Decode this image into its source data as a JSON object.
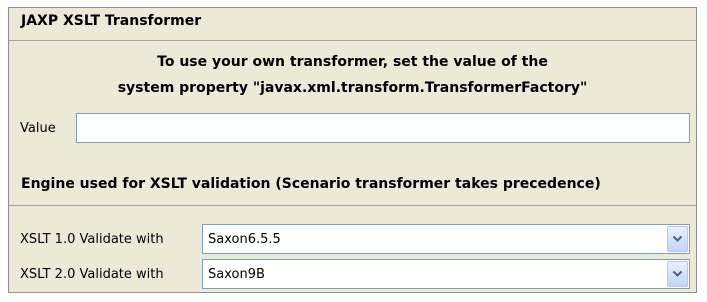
{
  "panel": {
    "title": "JAXP XSLT Transformer",
    "note_line1": "To use your own transformer, set the value of the",
    "note_line2": "system property \"javax.xml.transform.TransformerFactory\"",
    "value_label": "Value",
    "value_input": ""
  },
  "engine": {
    "title": "Engine used for XSLT validation (Scenario transformer takes precedence)",
    "rows": [
      {
        "label": "XSLT 1.0 Validate with",
        "selected": "Saxon6.5.5"
      },
      {
        "label": "XSLT 2.0 Validate with",
        "selected": "Saxon9B"
      }
    ]
  },
  "icons": {
    "dropdown": "chevron-down-icon"
  },
  "colors": {
    "panel_bg": "#ece9d8",
    "input_border": "#7f9db9",
    "dropdown_button": "#c2d4f7"
  }
}
